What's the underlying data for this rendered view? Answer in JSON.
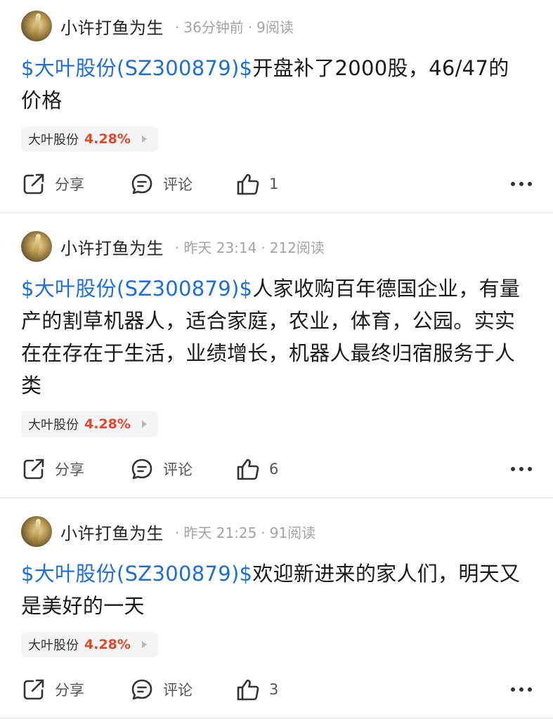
{
  "posts": [
    {
      "author": "小许打鱼为生",
      "time": "36分钟前",
      "reads": "9阅读",
      "stock_link": "$大叶股份(SZ300879)$",
      "text": "开盘补了2000股，46/47的价格",
      "tag": {
        "name": "大叶股份",
        "change": "4.28%"
      },
      "share_label": "分享",
      "comment_label": "评论",
      "likes": "1"
    },
    {
      "author": "小许打鱼为生",
      "time": "昨天 23:14",
      "reads": "212阅读",
      "stock_link": "$大叶股份(SZ300879)$",
      "text": "人家收购百年德国企业，有量产的割草机器人，适合家庭，农业，体育，公园。实实在在存在于生活，业绩增长，机器人最终归宿服务于人类",
      "tag": {
        "name": "大叶股份",
        "change": "4.28%"
      },
      "share_label": "分享",
      "comment_label": "评论",
      "likes": "6"
    },
    {
      "author": "小许打鱼为生",
      "time": "昨天 21:25",
      "reads": "91阅读",
      "stock_link": "$大叶股份(SZ300879)$",
      "text": "欢迎新进来的家人们，明天又是美好的一天",
      "tag": {
        "name": "大叶股份",
        "change": "4.28%"
      },
      "share_label": "分享",
      "comment_label": "评论",
      "likes": "3"
    }
  ],
  "colors": {
    "link": "#1f6fd1",
    "gain": "#e0472b",
    "meta": "#a3a3a3"
  }
}
